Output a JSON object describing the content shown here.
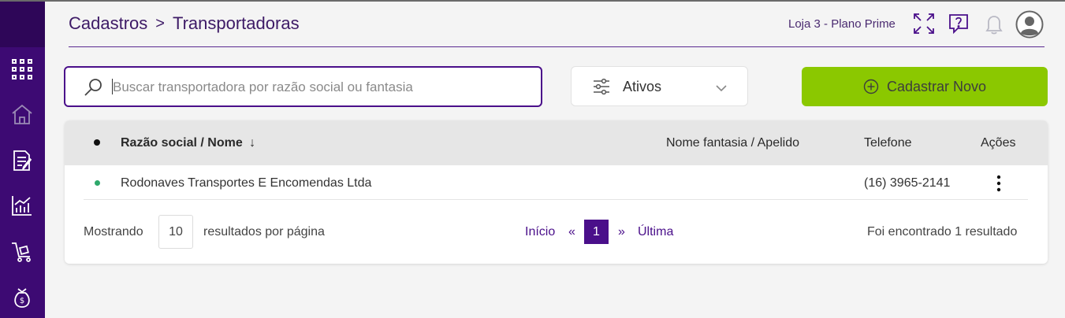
{
  "sidebar": {
    "items": [
      {
        "icon": "apps-grid-icon"
      },
      {
        "icon": "home-icon"
      },
      {
        "icon": "document-edit-icon"
      },
      {
        "icon": "chart-icon"
      },
      {
        "icon": "cart-icon"
      },
      {
        "icon": "money-bag-icon"
      }
    ]
  },
  "header": {
    "breadcrumb": [
      "Cadastros",
      "Transportadoras"
    ],
    "breadcrumb_separator": ">",
    "store": "Loja 3 - Plano Prime",
    "icons": [
      "fullscreen-icon",
      "help-icon",
      "bell-icon",
      "avatar-icon"
    ]
  },
  "search": {
    "placeholder": "Buscar transportadora por razão social ou fantasia",
    "value": ""
  },
  "filter": {
    "selected": "Ativos"
  },
  "new_button": {
    "label": "Cadastrar Novo"
  },
  "table": {
    "columns": {
      "name": "Razão social / Nome",
      "name_sort": "↓",
      "fantasy": "Nome fantasia / Apelido",
      "phone": "Telefone",
      "actions": "Ações"
    },
    "rows": [
      {
        "status": "active",
        "name": "Rodonaves Transportes E Encomendas Ltda",
        "fantasy": "",
        "phone": "(16) 3965-2141"
      }
    ]
  },
  "pagination": {
    "showing_label": "Mostrando",
    "page_size": "10",
    "per_page_label": "resultados por página",
    "first": "Início",
    "prev": "«",
    "current": "1",
    "next": "»",
    "last": "Última",
    "result_text": "Foi encontrado 1 resultado"
  },
  "colors": {
    "sidebar": "#3d0a73",
    "accent": "#4a0f8a",
    "primary_button": "#8bc800",
    "active_status": "#2ea86b"
  }
}
